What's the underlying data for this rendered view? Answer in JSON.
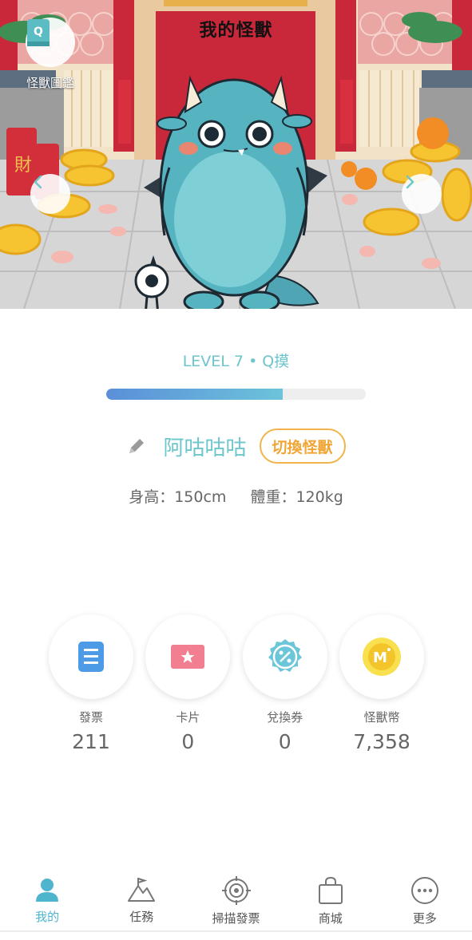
{
  "hero": {
    "title": "我的怪獸",
    "dex_label": "怪獸圖鑑",
    "dex_icon_letter": "Q",
    "prev_icon": "chevron-left-icon",
    "next_icon": "chevron-right-icon"
  },
  "level": {
    "text": "LEVEL 7 • Q摸",
    "progress": 0.68
  },
  "monster": {
    "name": "阿咕咕咕",
    "switch_label": "切換怪獸",
    "height": "身高：150cm",
    "weight": "體重：120kg"
  },
  "counters": [
    {
      "label": "發票",
      "value": "211",
      "icon": "invoice-icon"
    },
    {
      "label": "卡片",
      "value": "0",
      "icon": "card-icon"
    },
    {
      "label": "兌換券",
      "value": "0",
      "icon": "coupon-icon"
    },
    {
      "label": "怪獸幣",
      "value": "7,358",
      "icon": "monster-coin-icon"
    }
  ],
  "tabs": [
    {
      "label": "我的",
      "icon": "person-icon",
      "active": true
    },
    {
      "label": "任務",
      "icon": "mountain-icon",
      "active": false
    },
    {
      "label": "掃描發票",
      "icon": "target-icon",
      "active": false
    },
    {
      "label": "商城",
      "icon": "shopping-bag-icon",
      "active": false
    },
    {
      "label": "更多",
      "icon": "more-icon",
      "active": false
    }
  ],
  "colors": {
    "accent": "#6cc6cc",
    "switch_orange": "#f0a535",
    "active_tab": "#4fb5cf",
    "progress_start": "#5b8fd9"
  }
}
